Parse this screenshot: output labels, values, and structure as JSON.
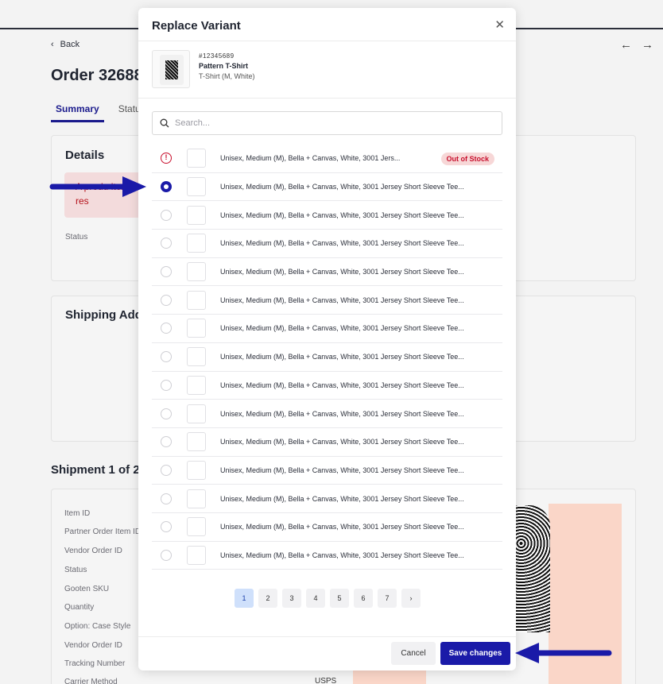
{
  "background": {
    "back_label": "Back",
    "order_title": "Order 32688",
    "tabs": [
      "Summary",
      "Status"
    ],
    "details_title": "Details",
    "alert_text": "A produ item to res",
    "status_label": "Status",
    "shipping_title": "Shipping Add",
    "shipment_title": "Shipment 1 of 2",
    "shipment_labels": [
      "Item ID",
      "Partner Order Item ID",
      "Vendor Order ID",
      "Status",
      "Gooten SKU",
      "Quantity",
      "Option: Case Style",
      "Vendor Order ID",
      "Tracking Number",
      "Carrier Method"
    ],
    "carrier_value": "USPS"
  },
  "modal": {
    "title": "Replace Variant",
    "close_icon": "close-icon",
    "product": {
      "id": "#12345689",
      "name": "Pattern T-Shirt",
      "variant": "T-Shirt (M, White)"
    },
    "search_placeholder": "Search...",
    "rows": [
      {
        "text": "Unisex, Medium (M), Bella + Canvas, White, 3001 Jers...",
        "state": "error",
        "badge": "Out of Stock"
      },
      {
        "text": "Unisex, Medium (M), Bella + Canvas, White, 3001 Jersey Short Sleeve Tee...",
        "state": "selected"
      },
      {
        "text": "Unisex, Medium (M), Bella + Canvas, White, 3001 Jersey Short Sleeve Tee...",
        "state": "unselected"
      },
      {
        "text": "Unisex, Medium (M), Bella + Canvas, White, 3001 Jersey Short Sleeve Tee...",
        "state": "unselected"
      },
      {
        "text": "Unisex, Medium (M), Bella + Canvas, White, 3001 Jersey Short Sleeve Tee...",
        "state": "unselected"
      },
      {
        "text": "Unisex, Medium (M), Bella + Canvas, White, 3001 Jersey Short Sleeve Tee...",
        "state": "unselected"
      },
      {
        "text": "Unisex, Medium (M), Bella + Canvas, White, 3001 Jersey Short Sleeve Tee...",
        "state": "unselected"
      },
      {
        "text": "Unisex, Medium (M), Bella + Canvas, White, 3001 Jersey Short Sleeve Tee...",
        "state": "unselected"
      },
      {
        "text": "Unisex, Medium (M), Bella + Canvas, White, 3001 Jersey Short Sleeve Tee...",
        "state": "unselected"
      },
      {
        "text": "Unisex, Medium (M), Bella + Canvas, White, 3001 Jersey Short Sleeve Tee...",
        "state": "unselected"
      },
      {
        "text": "Unisex, Medium (M), Bella + Canvas, White, 3001 Jersey Short Sleeve Tee...",
        "state": "unselected"
      },
      {
        "text": "Unisex, Medium (M), Bella + Canvas, White, 3001 Jersey Short Sleeve Tee...",
        "state": "unselected"
      },
      {
        "text": "Unisex, Medium (M), Bella + Canvas, White, 3001 Jersey Short Sleeve Tee...",
        "state": "unselected"
      },
      {
        "text": "Unisex, Medium (M), Bella + Canvas, White, 3001 Jersey Short Sleeve Tee...",
        "state": "unselected"
      },
      {
        "text": "Unisex, Medium (M), Bella + Canvas, White, 3001 Jersey Short Sleeve Tee...",
        "state": "unselected"
      }
    ],
    "pagination": {
      "pages": [
        "1",
        "2",
        "3",
        "4",
        "5",
        "6",
        "7"
      ],
      "current": "1",
      "next_icon": "chevron-right-icon"
    },
    "cancel_label": "Cancel",
    "save_label": "Save changes"
  },
  "colors": {
    "accent": "#1a1aa8",
    "error": "#c8102e",
    "badge_bg": "#f7d7d7",
    "annotation_arrow": "#1a1aa8"
  }
}
